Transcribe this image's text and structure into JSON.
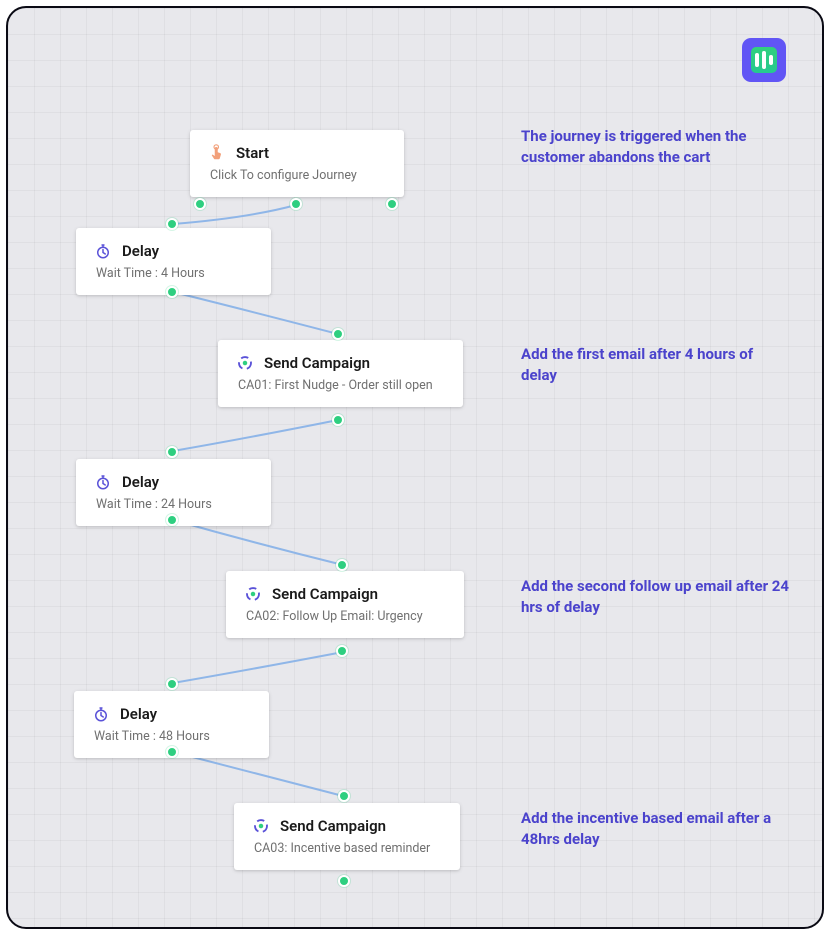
{
  "nodes": {
    "start": {
      "title": "Start",
      "subtitle": "Click To configure Journey"
    },
    "delay1": {
      "title": "Delay",
      "subtitle": "Wait Time : 4 Hours"
    },
    "camp1": {
      "title": "Send Campaign",
      "subtitle": "CA01: First Nudge - Order still open"
    },
    "delay2": {
      "title": "Delay",
      "subtitle": "Wait Time : 24 Hours"
    },
    "camp2": {
      "title": "Send Campaign",
      "subtitle": "CA02: Follow Up Email: Urgency"
    },
    "delay3": {
      "title": "Delay",
      "subtitle": "Wait Time : 48 Hours"
    },
    "camp3": {
      "title": "Send Campaign",
      "subtitle": "CA03: Incentive based reminder"
    }
  },
  "annotations": {
    "a1": "The journey is triggered when the customer abandons the cart",
    "a2": "Add the first email after 4 hours of delay",
    "a3": "Add the second follow up email after 24 hrs of delay",
    "a4": "Add the incentive based email after a 48hrs delay"
  },
  "colors": {
    "accent": "#4b43cc",
    "dot": "#2ecf80",
    "card": "#ffffff"
  }
}
